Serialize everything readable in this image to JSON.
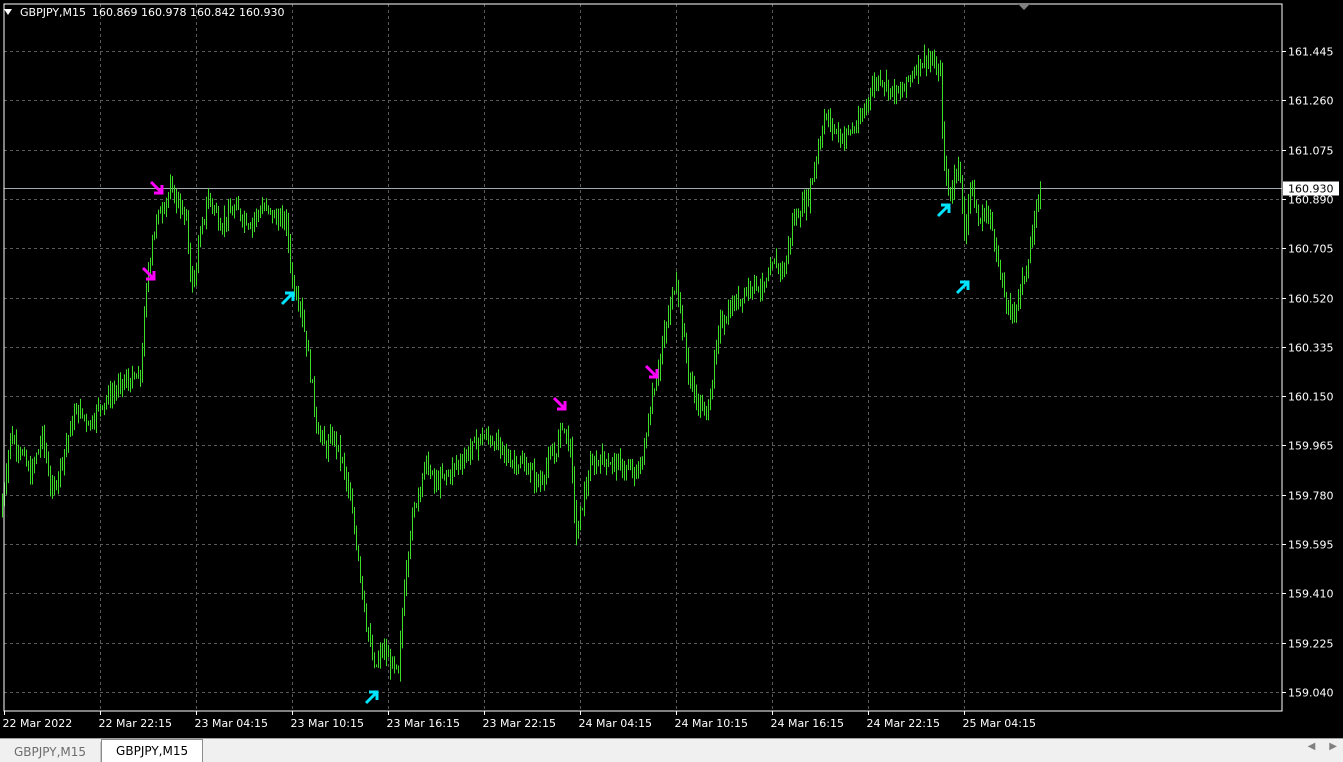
{
  "window": {
    "symbol_line": "GBPJPY,M15",
    "ohlc": "160.869 160.978 160.842 160.930"
  },
  "chart_data": {
    "type": "candlestick",
    "symbol": "GBPJPY",
    "timeframe": "M15",
    "ylim": [
      158.98,
      161.55
    ],
    "y_ticks": [
      161.445,
      161.26,
      161.075,
      160.89,
      160.705,
      160.52,
      160.335,
      160.15,
      159.965,
      159.78,
      159.595,
      159.41,
      159.225,
      159.04
    ],
    "current_price": 160.93,
    "current_price_label": "160.930",
    "x_labels": [
      "22 Mar 2022",
      "22 Mar 22:15",
      "23 Mar 04:15",
      "23 Mar 10:15",
      "23 Mar 16:15",
      "23 Mar 22:15",
      "24 Mar 04:15",
      "24 Mar 10:15",
      "24 Mar 16:15",
      "24 Mar 22:15",
      "25 Mar 04:15"
    ],
    "grid": true,
    "colors": {
      "bars": "#3cdc28",
      "grid": "#5a5a5a",
      "price_line": "#a0a8b0",
      "sell_arrow": "#ff00ff",
      "buy_arrow": "#00e5ff"
    },
    "price_path": [
      [
        0,
        159.7
      ],
      [
        10,
        160.0
      ],
      [
        20,
        159.95
      ],
      [
        30,
        159.85
      ],
      [
        42,
        160.0
      ],
      [
        52,
        159.78
      ],
      [
        64,
        159.95
      ],
      [
        76,
        160.1
      ],
      [
        90,
        160.05
      ],
      [
        100,
        160.12
      ],
      [
        112,
        160.16
      ],
      [
        124,
        160.2
      ],
      [
        140,
        160.22
      ],
      [
        146,
        160.55
      ],
      [
        152,
        160.75
      ],
      [
        160,
        160.85
      ],
      [
        170,
        160.92
      ],
      [
        178,
        160.88
      ],
      [
        186,
        160.8
      ],
      [
        192,
        160.55
      ],
      [
        200,
        160.75
      ],
      [
        208,
        160.9
      ],
      [
        220,
        160.8
      ],
      [
        235,
        160.85
      ],
      [
        250,
        160.8
      ],
      [
        262,
        160.86
      ],
      [
        275,
        160.82
      ],
      [
        286,
        160.8
      ],
      [
        292,
        160.58
      ],
      [
        300,
        160.5
      ],
      [
        308,
        160.3
      ],
      [
        316,
        160.05
      ],
      [
        325,
        159.95
      ],
      [
        333,
        160.0
      ],
      [
        342,
        159.9
      ],
      [
        350,
        159.75
      ],
      [
        358,
        159.55
      ],
      [
        366,
        159.3
      ],
      [
        374,
        159.12
      ],
      [
        382,
        159.2
      ],
      [
        390,
        159.15
      ],
      [
        398,
        159.1
      ],
      [
        404,
        159.45
      ],
      [
        410,
        159.65
      ],
      [
        418,
        159.8
      ],
      [
        426,
        159.9
      ],
      [
        434,
        159.82
      ],
      [
        446,
        159.85
      ],
      [
        458,
        159.9
      ],
      [
        470,
        159.95
      ],
      [
        482,
        160.0
      ],
      [
        494,
        159.98
      ],
      [
        506,
        159.92
      ],
      [
        518,
        159.9
      ],
      [
        528,
        159.88
      ],
      [
        538,
        159.82
      ],
      [
        548,
        159.9
      ],
      [
        556,
        159.95
      ],
      [
        562,
        160.05
      ],
      [
        570,
        159.95
      ],
      [
        576,
        159.62
      ],
      [
        582,
        159.75
      ],
      [
        590,
        159.88
      ],
      [
        600,
        159.92
      ],
      [
        612,
        159.9
      ],
      [
        624,
        159.88
      ],
      [
        636,
        159.85
      ],
      [
        644,
        159.95
      ],
      [
        650,
        160.12
      ],
      [
        660,
        160.3
      ],
      [
        668,
        160.45
      ],
      [
        676,
        160.6
      ],
      [
        684,
        160.35
      ],
      [
        690,
        160.2
      ],
      [
        698,
        160.12
      ],
      [
        706,
        160.08
      ],
      [
        712,
        160.22
      ],
      [
        720,
        160.42
      ],
      [
        730,
        160.48
      ],
      [
        740,
        160.52
      ],
      [
        752,
        160.58
      ],
      [
        764,
        160.55
      ],
      [
        774,
        160.65
      ],
      [
        784,
        160.62
      ],
      [
        792,
        160.8
      ],
      [
        800,
        160.85
      ],
      [
        808,
        160.9
      ],
      [
        816,
        161.05
      ],
      [
        824,
        161.2
      ],
      [
        834,
        161.15
      ],
      [
        842,
        161.12
      ],
      [
        852,
        161.15
      ],
      [
        860,
        161.18
      ],
      [
        870,
        161.3
      ],
      [
        880,
        161.35
      ],
      [
        890,
        161.3
      ],
      [
        900,
        161.28
      ],
      [
        910,
        161.35
      ],
      [
        918,
        161.4
      ],
      [
        928,
        161.42
      ],
      [
        940,
        161.35
      ],
      [
        944,
        161.0
      ],
      [
        950,
        160.9
      ],
      [
        958,
        161.05
      ],
      [
        964,
        160.75
      ],
      [
        970,
        160.95
      ],
      [
        978,
        160.8
      ],
      [
        986,
        160.85
      ],
      [
        994,
        160.75
      ],
      [
        1002,
        160.55
      ],
      [
        1010,
        160.45
      ],
      [
        1016,
        160.5
      ],
      [
        1024,
        160.6
      ],
      [
        1032,
        160.75
      ],
      [
        1040,
        160.93
      ]
    ],
    "signals": [
      {
        "type": "sell",
        "x": 157,
        "price": 160.93
      },
      {
        "type": "sell",
        "x": 149,
        "price": 160.61
      },
      {
        "type": "buy",
        "x": 288,
        "price": 160.52
      },
      {
        "type": "buy",
        "x": 372,
        "price": 159.02
      },
      {
        "type": "sell",
        "x": 560,
        "price": 160.12
      },
      {
        "type": "sell",
        "x": 652,
        "price": 160.24
      },
      {
        "type": "buy",
        "x": 944,
        "price": 160.85
      },
      {
        "type": "buy",
        "x": 963,
        "price": 160.56
      }
    ]
  },
  "tabs": [
    {
      "label": "GBPJPY,M15",
      "active": false
    },
    {
      "label": "GBPJPY,M15",
      "active": true
    }
  ]
}
